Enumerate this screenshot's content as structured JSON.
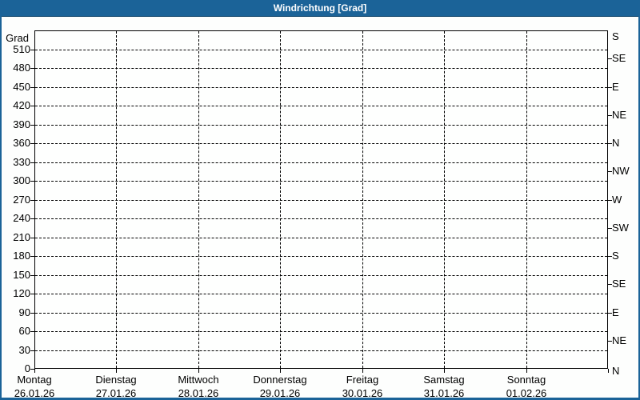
{
  "window": {
    "title": "Windrichtung [Grad]"
  },
  "colors": {
    "frame_blue": "#1B6398",
    "frame_blue_dark": "#0F456B",
    "page_bg": "#FDFEFD",
    "plot_bg": "#FEFFFE",
    "grid_color": "#000000",
    "text_color": "#000000",
    "title_text": "#FFFFFF"
  },
  "chart_data": {
    "type": "line",
    "title": "Windrichtung [Grad]",
    "grid": "dashed",
    "series": [],
    "y_axis_left": {
      "title": "Grad",
      "min": 0,
      "max": 540,
      "step": 30,
      "tick_labels": [
        "0",
        "30",
        "60",
        "90",
        "120",
        "150",
        "180",
        "210",
        "240",
        "270",
        "300",
        "330",
        "360",
        "390",
        "420",
        "450",
        "480",
        "510"
      ]
    },
    "y_axis_right": {
      "unit": "compass",
      "tick_step_deg": 45,
      "labels": [
        {
          "deg": 540,
          "label": "S"
        },
        {
          "deg": 495,
          "label": "SE"
        },
        {
          "deg": 450,
          "label": "E"
        },
        {
          "deg": 405,
          "label": "NE"
        },
        {
          "deg": 360,
          "label": "N"
        },
        {
          "deg": 315,
          "label": "NW"
        },
        {
          "deg": 270,
          "label": "W"
        },
        {
          "deg": 225,
          "label": "SW"
        },
        {
          "deg": 180,
          "label": "S"
        },
        {
          "deg": 135,
          "label": "SE"
        },
        {
          "deg": 90,
          "label": "E"
        },
        {
          "deg": 45,
          "label": "NE"
        },
        {
          "deg": 0,
          "label": "N"
        }
      ]
    },
    "x_axis": {
      "days": [
        {
          "weekday": "Montag",
          "date": "26.01.26"
        },
        {
          "weekday": "Dienstag",
          "date": "27.01.26"
        },
        {
          "weekday": "Mittwoch",
          "date": "28.01.26"
        },
        {
          "weekday": "Donnerstag",
          "date": "29.01.26"
        },
        {
          "weekday": "Freitag",
          "date": "30.01.26"
        },
        {
          "weekday": "Samstag",
          "date": "31.01.26"
        },
        {
          "weekday": "Sonntag",
          "date": "01.02.26"
        }
      ]
    }
  }
}
